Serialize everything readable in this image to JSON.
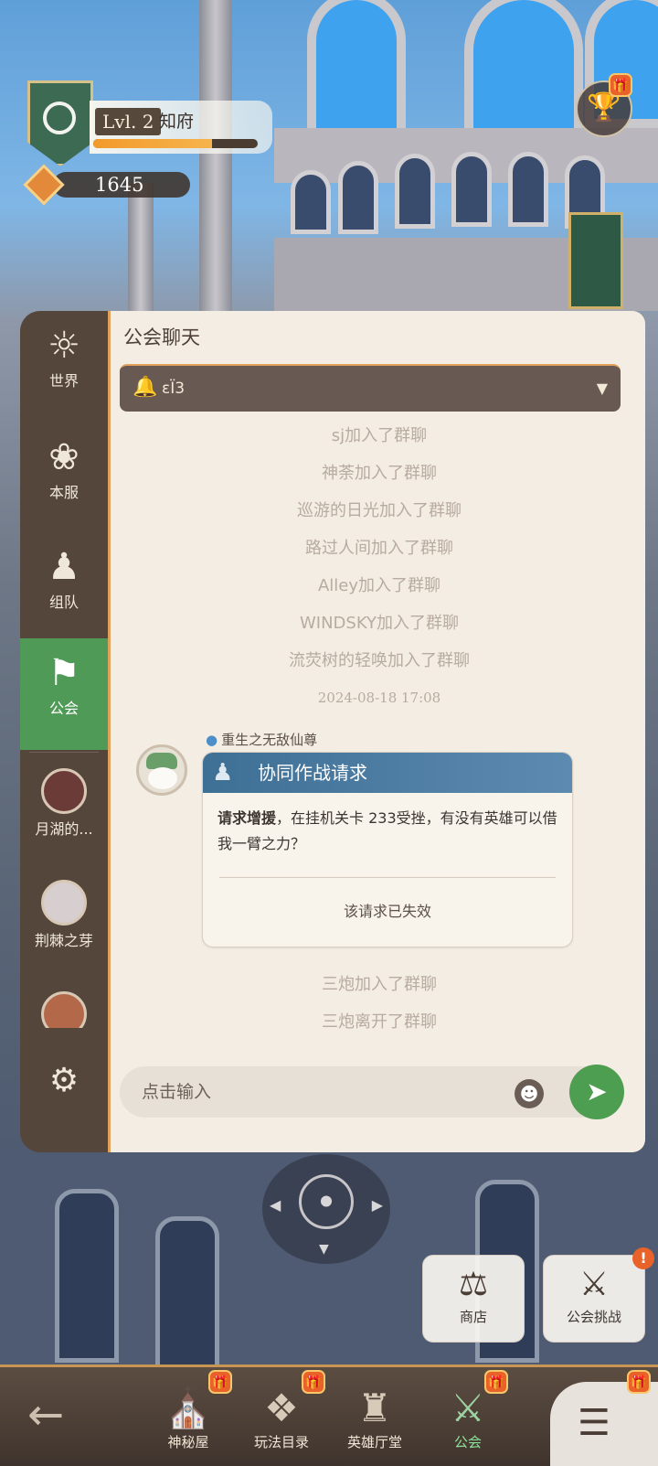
{
  "hud": {
    "level_tag": "Lvl. 2",
    "rank_title": "知府",
    "xp_progress": 0.72,
    "currency_value": "1645"
  },
  "chat": {
    "title": "公会聊天",
    "channel_name": "εЇ3",
    "sidebar": {
      "world": "世界",
      "server": "本服",
      "team": "组队",
      "guild": "公会",
      "dm1": "月湖的...",
      "dm2": "荆棘之芽"
    },
    "system_messages_top": [
      "sj加入了群聊",
      "神荼加入了群聊",
      "巡游的日光加入了群聊",
      "路过人间加入了群聊",
      "Alley加入了群聊",
      "WINDSKY加入了群聊",
      "流荧树的轻唤加入了群聊"
    ],
    "timestamp": "2024-08-18 17:08",
    "message": {
      "sender": "重生之无敌仙尊",
      "card_title": "协同作战请求",
      "body_bold": "请求增援",
      "body_text": "，在挂机关卡 233受挫，有没有英雄可以借我一臂之力？",
      "status": "该请求已失效"
    },
    "system_messages_bottom": [
      "三炮加入了群聊",
      "三炮离开了群聊"
    ],
    "input_placeholder": "点击输入"
  },
  "actions": {
    "shop": "商店",
    "guild_challenge": "公会挑战"
  },
  "bottom_nav": {
    "mystery_house": "神秘屋",
    "gameplay_catalog": "玩法目录",
    "hero_hall": "英雄厅堂",
    "guild": "公会"
  },
  "colors": {
    "guild_accent": "#4f9a57",
    "sidebar_bg": "#55463b",
    "panel_bg": "#f3ede4",
    "card_header": "#3e6f95",
    "alert": "#e8622a"
  }
}
